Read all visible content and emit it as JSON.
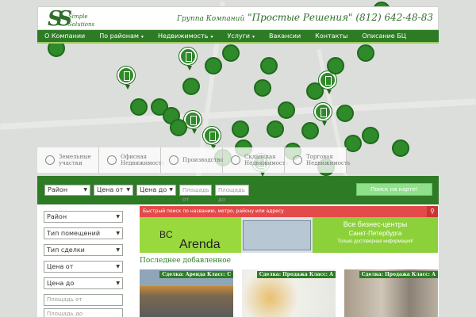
{
  "header": {
    "logo_text_1": "Simple",
    "logo_text_2": "Solutions",
    "company_prefix": "Группа Компаний",
    "company_name": "\"Простые Решения\"",
    "phone": "(812) 642-48-83"
  },
  "nav": {
    "items": [
      {
        "label": "О Компании",
        "has_caret": false
      },
      {
        "label": "По районам",
        "has_caret": true
      },
      {
        "label": "Недвижимость",
        "has_caret": true
      },
      {
        "label": "Услуги",
        "has_caret": true
      },
      {
        "label": "Вакансии",
        "has_caret": false
      },
      {
        "label": "Контакты",
        "has_caret": false
      },
      {
        "label": "Описание БЦ",
        "has_caret": false
      }
    ]
  },
  "categories": [
    {
      "line1": "Земельные",
      "line2": "участки"
    },
    {
      "line1": "Офисная",
      "line2": "Недвижимость"
    },
    {
      "line1": "Производство",
      "line2": ""
    },
    {
      "line1": "Складская",
      "line2": "Недвижимость"
    },
    {
      "line1": "Торговая",
      "line2": "Недвижимость"
    }
  ],
  "filterbar": {
    "district": "Район",
    "price_from": "Цена от",
    "price_to": "Цена до",
    "area_from_placeholder": "Площадь от",
    "area_to_placeholder": "Площадь до",
    "map_search_label": "Поиск на карте!"
  },
  "sidebar": {
    "district": "Район",
    "room_type": "Тип помещений",
    "deal_type": "Тип сделки",
    "price_from": "Цена от",
    "price_to": "Цена до",
    "area_from_placeholder": "Площадь от",
    "area_to_placeholder": "Площадь до"
  },
  "quick_search": {
    "placeholder": "Быстрый поиск по названию, метро, району или адресу",
    "icon": "search-icon"
  },
  "banner": {
    "brand_a": "Arenda",
    "brand_b": "BC",
    "line1": "Все бизнес-центры",
    "line2": "Санкт-Петербурга",
    "line3": "Только достоверная информация!"
  },
  "latest": {
    "title": "Последнее добавленное",
    "cards": [
      {
        "label": "Сделка: Аренда Класс: С"
      },
      {
        "label": "Сделка: Продажа Класс: А"
      },
      {
        "label": "Сделка: Продажа Класс: А"
      }
    ]
  },
  "colors": {
    "brand_green": "#2e7b26",
    "accent_light_green": "#9ad93e",
    "quick_search_red": "#e34a4a"
  }
}
